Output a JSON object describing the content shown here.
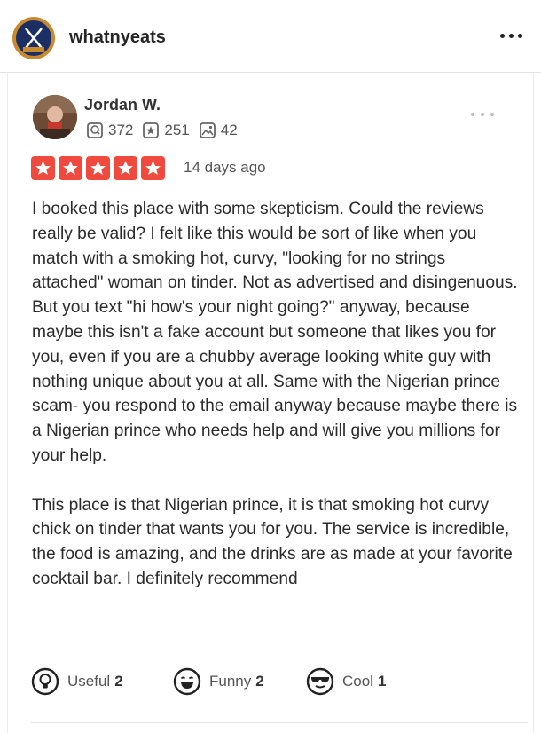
{
  "header": {
    "account_name": "whatnyeats"
  },
  "review": {
    "author_name": "Jordan W.",
    "stats": {
      "reviews_count": "372",
      "friends_count": "251",
      "photos_count": "42"
    },
    "rating": 5,
    "rating_max": 5,
    "date": "14 days ago",
    "paragraphs": [
      "I booked this place with some skepticism. Could the reviews really be valid? I felt like this would be sort of like when you match with a smoking hot, curvy, \"looking for no strings attached\" woman on tinder. Not as advertised and disingenuous. But you text \"hi how's your night going?\" anyway, because maybe this isn't a fake account but someone that likes you for you, even if you are a chubby average looking white guy with nothing unique about you at all. Same with the Nigerian prince scam- you respond to the email anyway because maybe there is a Nigerian prince who needs help and will give you millions for your help.",
      "This place is that Nigerian prince, it is that smoking hot curvy chick on tinder that wants you for you. The service is incredible, the food is amazing, and the drinks are as made at your favorite cocktail bar. I definitely recommend"
    ],
    "reactions": {
      "useful": {
        "label": "Useful",
        "count": "2"
      },
      "funny": {
        "label": "Funny",
        "count": "2"
      },
      "cool": {
        "label": "Cool",
        "count": "1"
      }
    }
  },
  "colors": {
    "star_red": "#f04a3e",
    "avatar_ring": "#c98a2e",
    "avatar_navy": "#1c2f64"
  }
}
